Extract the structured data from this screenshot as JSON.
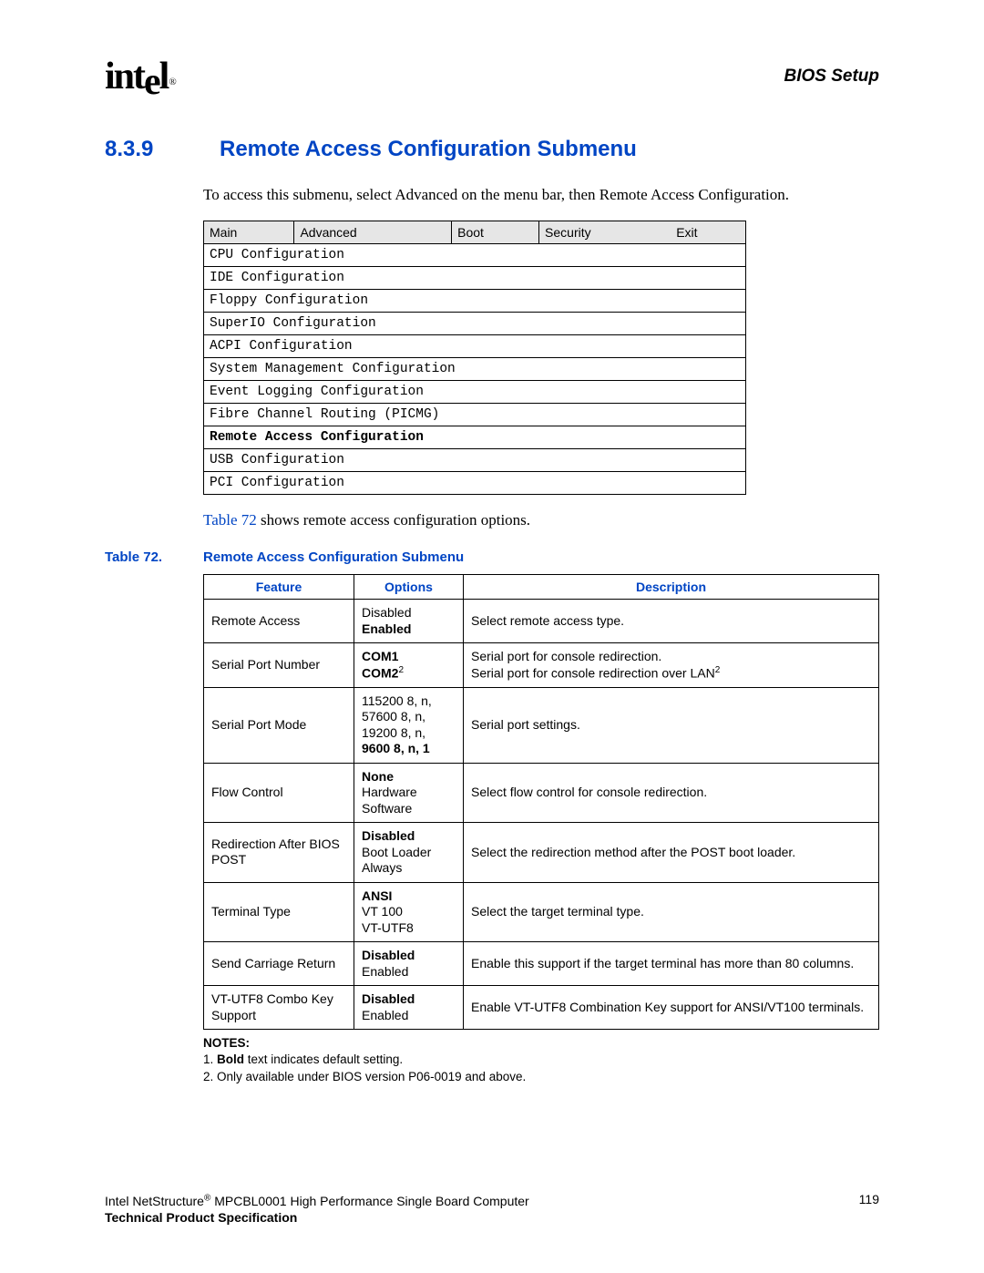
{
  "header": {
    "logo": "intel",
    "right": "BIOS Setup"
  },
  "section": {
    "number": "8.3.9",
    "title": "Remote Access Configuration Submenu"
  },
  "intro": "To access this submenu, select Advanced on the menu bar, then Remote Access Configuration.",
  "menu": {
    "tabs": [
      "Main",
      "Advanced",
      "Boot",
      "Security",
      "Exit"
    ],
    "items": [
      {
        "label": "CPU Configuration",
        "bold": false
      },
      {
        "label": "IDE Configuration",
        "bold": false
      },
      {
        "label": "Floppy Configuration",
        "bold": false
      },
      {
        "label": "SuperIO Configuration",
        "bold": false
      },
      {
        "label": "ACPI Configuration",
        "bold": false
      },
      {
        "label": "System Management Configuration",
        "bold": false
      },
      {
        "label": "Event Logging Configuration",
        "bold": false
      },
      {
        "label": "Fibre Channel Routing (PICMG)",
        "bold": false
      },
      {
        "label": "Remote Access Configuration",
        "bold": true
      },
      {
        "label": "USB Configuration",
        "bold": false
      },
      {
        "label": "PCI Configuration",
        "bold": false
      }
    ]
  },
  "caption_line": {
    "link": "Table 72",
    "rest": " shows remote access configuration options."
  },
  "table_caption": {
    "num": "Table 72.",
    "title": "Remote Access Configuration Submenu"
  },
  "opt_headers": [
    "Feature",
    "Options",
    "Description"
  ],
  "rows": [
    {
      "feature": "Remote Access",
      "options": [
        {
          "t": "Disabled",
          "b": false
        },
        {
          "t": "Enabled",
          "b": true
        }
      ],
      "desc": "Select remote access type."
    },
    {
      "feature": "Serial Port Number",
      "options": [
        {
          "t": "COM1",
          "b": true
        },
        {
          "t": "COM2",
          "b": true,
          "sup": "2"
        }
      ],
      "desc_lines": [
        {
          "t": "Serial port for console redirection."
        },
        {
          "t": "Serial port for console redirection over LAN",
          "sup": "2"
        }
      ]
    },
    {
      "feature": "Serial Port Mode",
      "options": [
        {
          "t": "115200 8, n,",
          "b": false
        },
        {
          "t": "57600 8, n,",
          "b": false
        },
        {
          "t": "19200 8, n,",
          "b": false
        },
        {
          "t": "9600 8, n, 1",
          "b": true
        }
      ],
      "desc": "Serial port settings."
    },
    {
      "feature": "Flow Control",
      "options": [
        {
          "t": "None",
          "b": true
        },
        {
          "t": "Hardware",
          "b": false
        },
        {
          "t": "Software",
          "b": false
        }
      ],
      "desc": "Select flow control for console redirection."
    },
    {
      "feature": "Redirection After BIOS POST",
      "options": [
        {
          "t": "Disabled",
          "b": true
        },
        {
          "t": "Boot Loader",
          "b": false
        },
        {
          "t": "Always",
          "b": false
        }
      ],
      "desc": "Select the redirection method after the POST boot loader."
    },
    {
      "feature": "Terminal Type",
      "options": [
        {
          "t": "ANSI",
          "b": true
        },
        {
          "t": "VT 100",
          "b": false
        },
        {
          "t": "VT-UTF8",
          "b": false
        }
      ],
      "desc": "Select the target terminal type."
    },
    {
      "feature": "Send Carriage Return",
      "options": [
        {
          "t": "Disabled",
          "b": true
        },
        {
          "t": "Enabled",
          "b": false
        }
      ],
      "desc": "Enable this support if the target terminal has more than 80 columns."
    },
    {
      "feature": "VT-UTF8 Combo Key Support",
      "options": [
        {
          "t": "Disabled",
          "b": true
        },
        {
          "t": "Enabled",
          "b": false
        }
      ],
      "desc": "Enable VT-UTF8 Combination Key support for ANSI/VT100 terminals."
    }
  ],
  "notes": {
    "hdr": "NOTES:",
    "n1a": "1. ",
    "n1b": "Bold",
    "n1c": " text indicates default setting.",
    "n2": "2. Only available under BIOS version P06-0019 and above."
  },
  "footer": {
    "line1a": "Intel NetStructure",
    "line1b": " MPCBL0001 High Performance Single Board Computer",
    "line2": "Technical Product Specification",
    "page": "119"
  }
}
